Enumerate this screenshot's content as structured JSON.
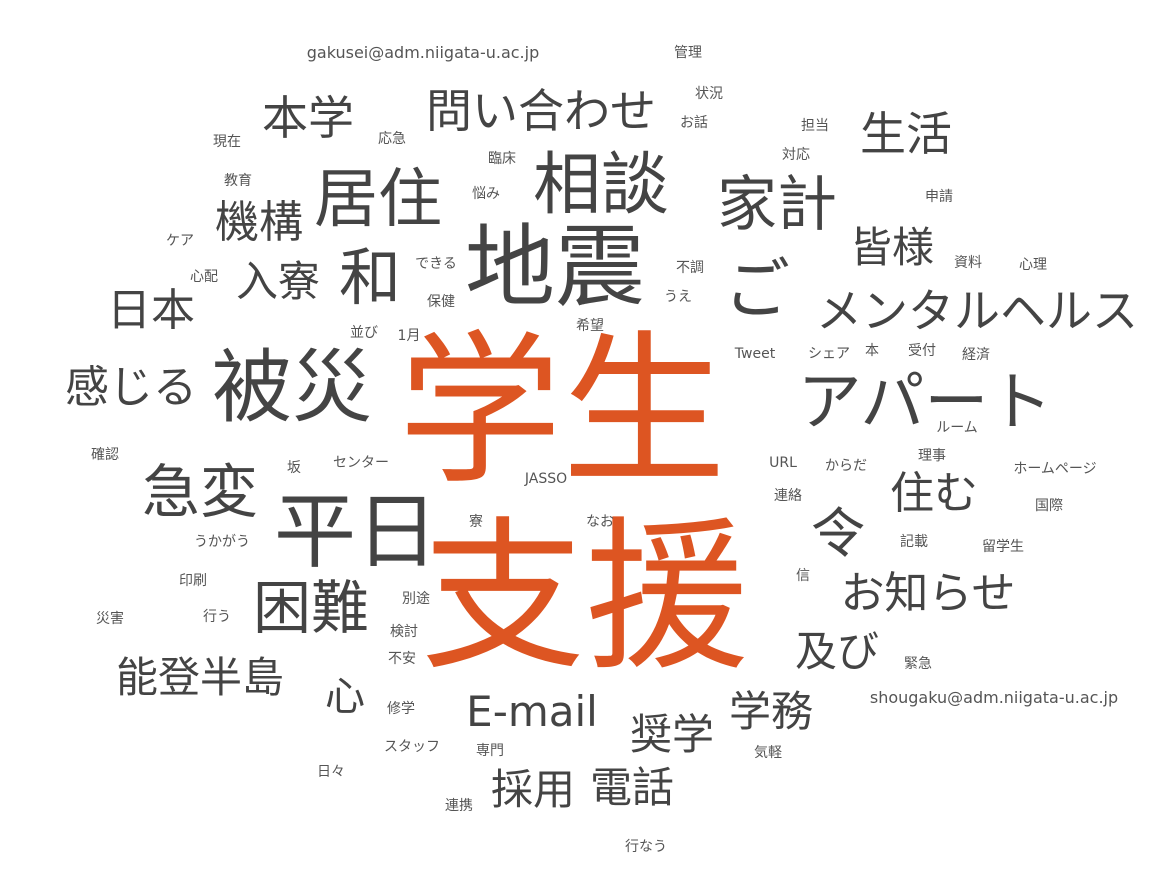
{
  "colors": {
    "accent": "#dd5522",
    "text": "#444444",
    "background": "#ffffff"
  },
  "words": [
    {
      "text": "学生",
      "accent": true
    },
    {
      "text": "支援",
      "accent": true
    },
    {
      "text": "地震"
    },
    {
      "text": "相談"
    },
    {
      "text": "被災"
    },
    {
      "text": "平日"
    },
    {
      "text": "居住"
    },
    {
      "text": "家計"
    },
    {
      "text": "アパート"
    },
    {
      "text": "急変"
    },
    {
      "text": "困難"
    },
    {
      "text": "和"
    },
    {
      "text": "ご"
    },
    {
      "text": "問い合わせ"
    },
    {
      "text": "メンタルヘルス"
    },
    {
      "text": "令"
    },
    {
      "text": "本学"
    },
    {
      "text": "生活"
    },
    {
      "text": "機構"
    },
    {
      "text": "日本"
    },
    {
      "text": "入寮"
    },
    {
      "text": "皆様"
    },
    {
      "text": "感じる"
    },
    {
      "text": "住む"
    },
    {
      "text": "お知らせ"
    },
    {
      "text": "能登半島"
    },
    {
      "text": "及び"
    },
    {
      "text": "E-mail"
    },
    {
      "text": "学務"
    },
    {
      "text": "奨学"
    },
    {
      "text": "採用"
    },
    {
      "text": "電話"
    },
    {
      "text": "心"
    },
    {
      "text": "gakusei@adm.niigata-u.ac.jp"
    },
    {
      "text": "shougaku@adm.niigata-u.ac.jp"
    },
    {
      "text": "管理"
    },
    {
      "text": "状況"
    },
    {
      "text": "お話"
    },
    {
      "text": "担当"
    },
    {
      "text": "対応"
    },
    {
      "text": "現在"
    },
    {
      "text": "応急"
    },
    {
      "text": "臨床"
    },
    {
      "text": "悩み"
    },
    {
      "text": "教育"
    },
    {
      "text": "申請"
    },
    {
      "text": "ケア"
    },
    {
      "text": "心配"
    },
    {
      "text": "できる"
    },
    {
      "text": "不調"
    },
    {
      "text": "資料"
    },
    {
      "text": "心理"
    },
    {
      "text": "保健"
    },
    {
      "text": "うえ"
    },
    {
      "text": "希望"
    },
    {
      "text": "並び"
    },
    {
      "text": "1月"
    },
    {
      "text": "Tweet"
    },
    {
      "text": "シェア"
    },
    {
      "text": "本"
    },
    {
      "text": "受付"
    },
    {
      "text": "経済"
    },
    {
      "text": "ルーム"
    },
    {
      "text": "確認"
    },
    {
      "text": "坂"
    },
    {
      "text": "センター"
    },
    {
      "text": "URL"
    },
    {
      "text": "からだ"
    },
    {
      "text": "理事"
    },
    {
      "text": "ホームページ"
    },
    {
      "text": "JASSO"
    },
    {
      "text": "連絡"
    },
    {
      "text": "国際"
    },
    {
      "text": "寮"
    },
    {
      "text": "なお"
    },
    {
      "text": "うかがう"
    },
    {
      "text": "記載"
    },
    {
      "text": "留学生"
    },
    {
      "text": "印刷"
    },
    {
      "text": "信"
    },
    {
      "text": "災害"
    },
    {
      "text": "行う"
    },
    {
      "text": "別途"
    },
    {
      "text": "検討"
    },
    {
      "text": "緊急"
    },
    {
      "text": "不安"
    },
    {
      "text": "修学"
    },
    {
      "text": "スタッフ"
    },
    {
      "text": "専門"
    },
    {
      "text": "気軽"
    },
    {
      "text": "日々"
    },
    {
      "text": "連携"
    },
    {
      "text": "行なう"
    }
  ]
}
